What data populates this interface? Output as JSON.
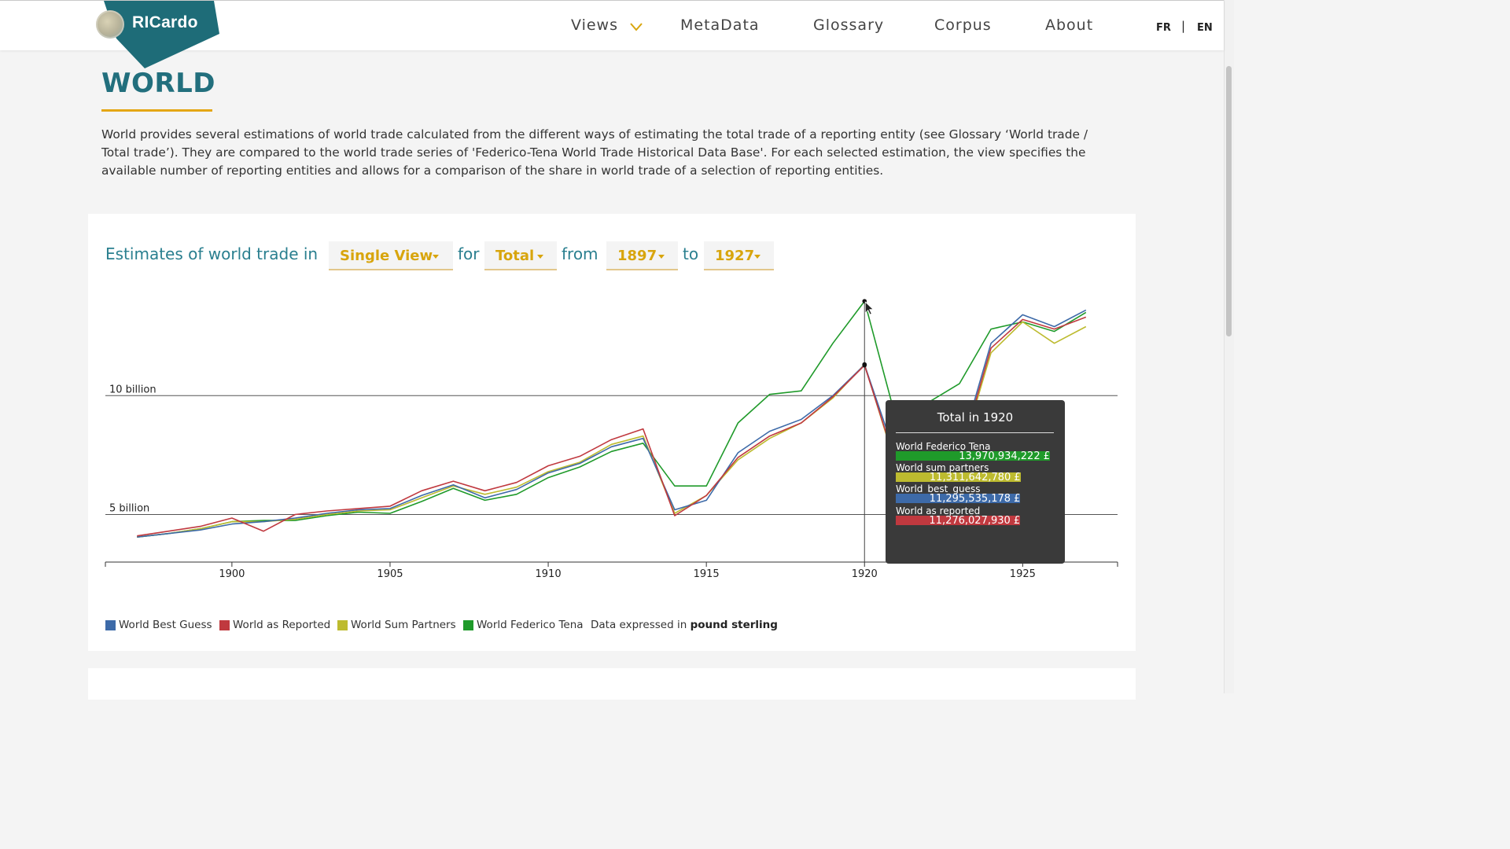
{
  "header": {
    "logo_text": "RICardo",
    "nav": [
      {
        "label": "Views",
        "has_dropdown": true
      },
      {
        "label": "MetaData"
      },
      {
        "label": "Glossary"
      },
      {
        "label": "Corpus"
      },
      {
        "label": "About"
      }
    ],
    "languages": [
      "FR",
      "EN"
    ],
    "language_separator": "|"
  },
  "page": {
    "title": "WORLD",
    "intro": "World provides several estimations of world trade calculated from the different ways of estimating the total trade of a reporting entity (see Glossary ‘World trade / Total trade’). They are compared to the world trade series of 'Federico-Tena World Trade Historical Data Base'. For each selected estimation, the view specifies the available number of reporting entities and allows for a comparison of the share in world trade of a selection of reporting entities."
  },
  "controls": {
    "prefix": "Estimates of world trade in",
    "view": "Single View",
    "for_label": "for",
    "flow": "Total",
    "from_label": "from",
    "start_year": "1897",
    "to_label": "to",
    "end_year": "1927"
  },
  "colors": {
    "accent": "#d8a50d",
    "brand": "#1e6c78",
    "best_guess": "#3d6aa8",
    "as_reported": "#c0393f",
    "sum_partners": "#bdbb2f",
    "federico_tena": "#1f9a2a"
  },
  "icons": {
    "nav_views": "chevron-down-icon",
    "logo": "globe-icon",
    "dropdowns": "caret-down-icon",
    "cursor": "mouse-pointer-icon"
  },
  "chart_data": {
    "type": "line",
    "x": [
      1897,
      1898,
      1899,
      1900,
      1901,
      1902,
      1903,
      1904,
      1905,
      1906,
      1907,
      1908,
      1909,
      1910,
      1911,
      1912,
      1913,
      1914,
      1915,
      1916,
      1917,
      1918,
      1919,
      1920,
      1921,
      1922,
      1923,
      1924,
      1925,
      1926,
      1927
    ],
    "ylim": [
      3000000000,
      15000000000
    ],
    "xlim": [
      1896,
      1928
    ],
    "xticks": [
      1900,
      1905,
      1910,
      1915,
      1920,
      1925
    ],
    "ygrid": [
      {
        "value": 10000000000,
        "label": "10 billion"
      },
      {
        "value": 5000000000,
        "label": "5 billion"
      }
    ],
    "series": [
      {
        "name": "World Federico Tena",
        "color": "#1f9a2a",
        "values": [
          4050000000.0,
          4200000000.0,
          4400000000.0,
          4700000000.0,
          4750000000.0,
          4750000000.0,
          4950000000.0,
          5100000000.0,
          5050000000.0,
          5550000000.0,
          6100000000.0,
          5600000000.0,
          5850000000.0,
          6550000000.0,
          7000000000.0,
          7650000000.0,
          8000000000.0,
          6200000000.0,
          6200000000.0,
          8850000000.0,
          10050000000.0,
          10200000000.0,
          12200000000.0,
          13970934222.0,
          9000000000.0,
          9700000000.0,
          10500000000.0,
          12800000000.0,
          13100000000.0,
          12700000000.0,
          13500000000.0
        ]
      },
      {
        "name": "World Sum Partners",
        "color": "#bdbb2f",
        "values": [
          4050000000.0,
          4200000000.0,
          4400000000.0,
          4700000000.0,
          4700000000.0,
          4800000000.0,
          5000000000.0,
          5150000000.0,
          5200000000.0,
          5700000000.0,
          6200000000.0,
          5850000000.0,
          6150000000.0,
          6800000000.0,
          7200000000.0,
          7950000000.0,
          8300000000.0,
          5050000000.0,
          5800000000.0,
          7300000000.0,
          8200000000.0,
          8850000000.0,
          9900000000.0,
          11311642780.0,
          7000000000.0,
          6900000000.0,
          7300000000.0,
          11800000000.0,
          13100000000.0,
          12200000000.0,
          12900000000.0
        ]
      },
      {
        "name": "World Best Guess",
        "color": "#3d6aa8",
        "values": [
          4050000000.0,
          4200000000.0,
          4350000000.0,
          4600000000.0,
          4700000000.0,
          4850000000.0,
          5050000000.0,
          5200000000.0,
          5250000000.0,
          5800000000.0,
          6250000000.0,
          5700000000.0,
          6050000000.0,
          6750000000.0,
          7150000000.0,
          7850000000.0,
          8200000000.0,
          5200000000.0,
          5600000000.0,
          7600000000.0,
          8500000000.0,
          9000000000.0,
          10000000000.0,
          11295535178.0,
          7400000000.0,
          7250000000.0,
          7600000000.0,
          12200000000.0,
          13400000000.0,
          12900000000.0,
          13600000000.0
        ]
      },
      {
        "name": "World as Reported",
        "color": "#c0393f",
        "values": [
          4100000000.0,
          4300000000.0,
          4500000000.0,
          4850000000.0,
          4300000000.0,
          5000000000.0,
          5150000000.0,
          5250000000.0,
          5350000000.0,
          6000000000.0,
          6400000000.0,
          6000000000.0,
          6350000000.0,
          7050000000.0,
          7450000000.0,
          8150000000.0,
          8600000000.0,
          4950000000.0,
          5800000000.0,
          7400000000.0,
          8300000000.0,
          8850000000.0,
          9950000000.0,
          11276027930.0,
          7100000000.0,
          7000000000.0,
          7400000000.0,
          12000000000.0,
          13200000000.0,
          12800000000.0,
          13300000000.0
        ]
      }
    ],
    "hover": {
      "year": 1920,
      "title": "Total in 1920",
      "rows": [
        {
          "label": "World Federico Tena",
          "value": "13,970,934,222 £",
          "color": "#1f9a2a",
          "amount": 13970934222
        },
        {
          "label": "World sum partners",
          "value": "11,311,642,780 £",
          "color": "#bdbb2f",
          "amount": 11311642780
        },
        {
          "label": "World_best_guess",
          "value": "11,295,535,178 £",
          "color": "#3d6aa8",
          "amount": 11295535178
        },
        {
          "label": "World as reported",
          "value": "11,276,027,930 £",
          "color": "#c0393f",
          "amount": 11276027930
        }
      ]
    },
    "legend": [
      {
        "label": "World Best Guess",
        "color": "#3d6aa8"
      },
      {
        "label": "World as Reported",
        "color": "#c0393f"
      },
      {
        "label": "World Sum Partners",
        "color": "#bdbb2f"
      },
      {
        "label": "World Federico Tena",
        "color": "#1f9a2a"
      }
    ],
    "unit_prefix": "Data expressed in",
    "unit": "pound sterling"
  }
}
